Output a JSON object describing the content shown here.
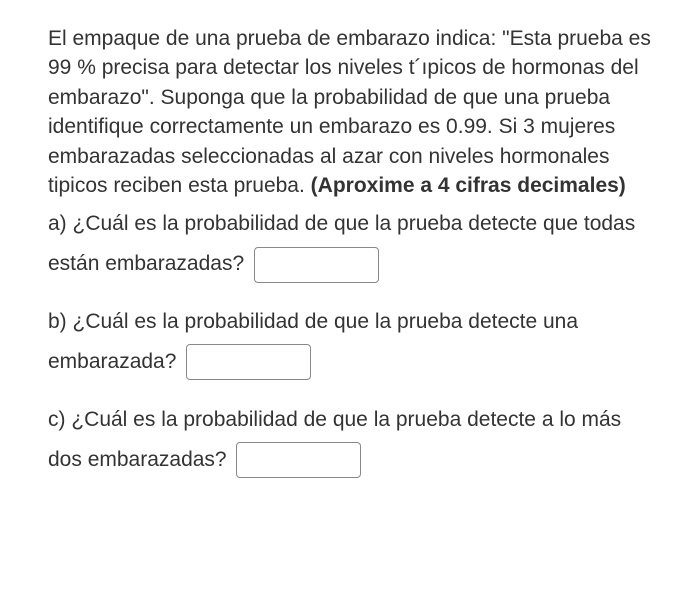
{
  "stem": {
    "text1": "El empaque de una prueba de embarazo indica: \"Esta prueba es 99 % precisa para detectar los niveles t´ıpicos de hormonas del embarazo\". Suponga que la probabilidad de que una prueba identifique correctamente un embarazo es 0.99.  Si 3 mujeres embarazadas seleccionadas al azar con niveles hormonales tipicos reciben esta prueba. ",
    "bold": "(Aproxime a 4 cifras decimales)"
  },
  "parts": {
    "a": {
      "text": "a) ¿Cuál es la probabilidad de que la prueba detecte que todas están embarazadas? "
    },
    "b": {
      "text": "b) ¿Cuál es la probabilidad de que la prueba detecte una embarazada? "
    },
    "c": {
      "text": "c)  ¿Cuál es la probabilidad de que la prueba  detecte a lo más dos embarazadas? "
    }
  }
}
